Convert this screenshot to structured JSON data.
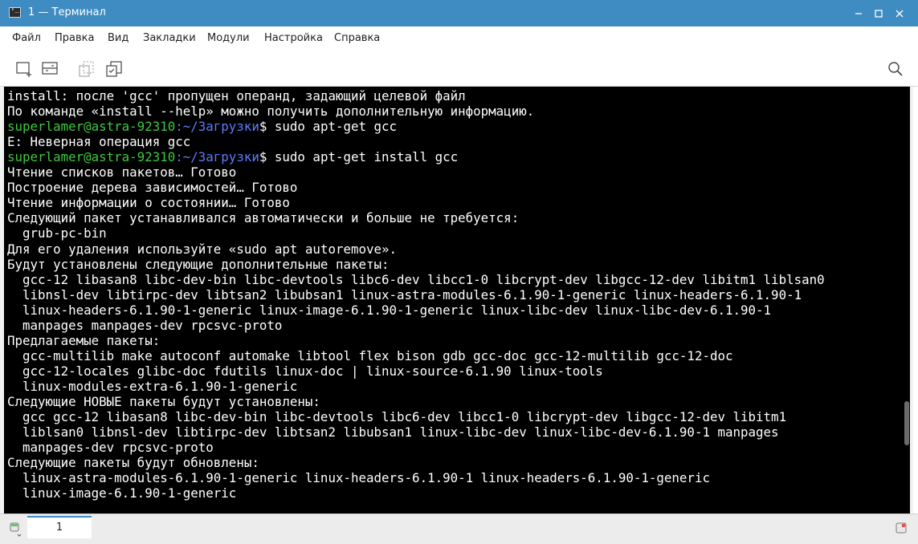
{
  "window": {
    "title": "1 — Терминал",
    "icons": {
      "app": "terminal-icon",
      "minimize": "minimize-icon",
      "maximize": "maximize-icon",
      "close": "close-icon"
    }
  },
  "menu": {
    "items": [
      "Файл",
      "Правка",
      "Вид",
      "Закладки",
      "Модули",
      "Настройка",
      "Справка"
    ]
  },
  "toolbar": {
    "icons": [
      "new-tab-icon",
      "split-view-icon",
      "copy-icon",
      "paste-icon",
      "search-icon"
    ]
  },
  "terminal": {
    "prompt_user": "superlamer@astra-92310",
    "prompt_path": ":~/Загрузки",
    "lines": [
      {
        "text": "install: после 'gcc' пропущен операнд, задающий целевой файл"
      },
      {
        "text": "По команде «install --help» можно получить дополнительную информацию."
      },
      {
        "prompt": true,
        "cmd": "$ sudo apt-get gcc"
      },
      {
        "text": "E: Неверная операция gcc"
      },
      {
        "prompt": true,
        "cmd": "$ sudo apt-get install gcc"
      },
      {
        "text": "Чтение списков пакетов… Готово"
      },
      {
        "text": "Построение дерева зависимостей… Готово"
      },
      {
        "text": "Чтение информации о состоянии… Готово"
      },
      {
        "text": "Следующий пакет устанавливался автоматически и больше не требуется:"
      },
      {
        "text": "  grub-pc-bin"
      },
      {
        "text": "Для его удаления используйте «sudo apt autoremove»."
      },
      {
        "text": "Будут установлены следующие дополнительные пакеты:"
      },
      {
        "text": "  gcc-12 libasan8 libc-dev-bin libc-devtools libc6-dev libcc1-0 libcrypt-dev libgcc-12-dev libitm1 liblsan0"
      },
      {
        "text": "  libnsl-dev libtirpc-dev libtsan2 libubsan1 linux-astra-modules-6.1.90-1-generic linux-headers-6.1.90-1"
      },
      {
        "text": "  linux-headers-6.1.90-1-generic linux-image-6.1.90-1-generic linux-libc-dev linux-libc-dev-6.1.90-1"
      },
      {
        "text": "  manpages manpages-dev rpcsvc-proto"
      },
      {
        "text": "Предлагаемые пакеты:"
      },
      {
        "text": "  gcc-multilib make autoconf automake libtool flex bison gdb gcc-doc gcc-12-multilib gcc-12-doc"
      },
      {
        "text": "  gcc-12-locales glibc-doc fdutils linux-doc | linux-source-6.1.90 linux-tools"
      },
      {
        "text": "  linux-modules-extra-6.1.90-1-generic"
      },
      {
        "text": "Следующие НОВЫЕ пакеты будут установлены:"
      },
      {
        "text": "  gcc gcc-12 libasan8 libc-dev-bin libc-devtools libc6-dev libcc1-0 libcrypt-dev libgcc-12-dev libitm1"
      },
      {
        "text": "  liblsan0 libnsl-dev libtirpc-dev libtsan2 libubsan1 linux-libc-dev linux-libc-dev-6.1.90-1 manpages"
      },
      {
        "text": "  manpages-dev rpcsvc-proto"
      },
      {
        "text": "Следующие пакеты будут обновлены:"
      },
      {
        "text": "  linux-astra-modules-6.1.90-1-generic linux-headers-6.1.90-1 linux-headers-6.1.90-1-generic"
      },
      {
        "text": "  linux-image-6.1.90-1-generic"
      }
    ]
  },
  "tabs": {
    "items": [
      {
        "label": "1"
      }
    ],
    "icons": {
      "new": "new-tab-menu-icon",
      "close": "close-tab-icon"
    }
  },
  "colors": {
    "titlebar": "#3f8cc2",
    "prompt_user": "#3ec93e",
    "prompt_path": "#5d7bff",
    "terminal_bg": "#000000",
    "terminal_fg": "#ffffff"
  }
}
